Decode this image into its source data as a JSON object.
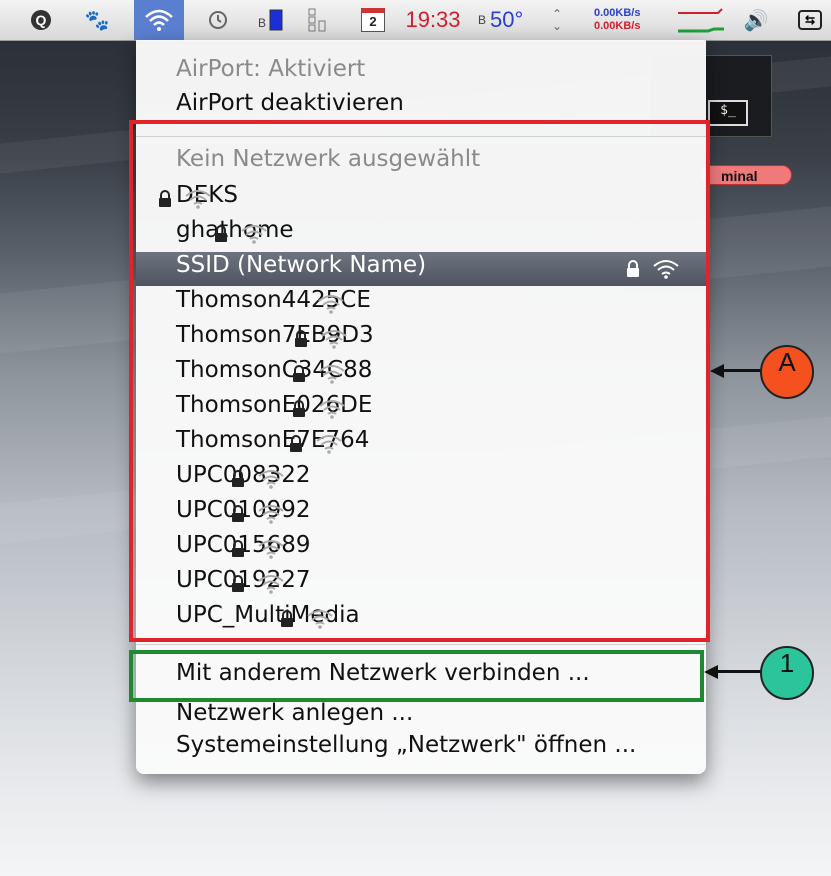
{
  "menubar": {
    "status_icons": [
      "q-icon",
      "paw-icon",
      "wifi-icon",
      "time-machine-icon",
      "battery-icon",
      "cpu-icon",
      "calendar-icon",
      "volume-icon",
      "input-menu-icon"
    ],
    "calendar_day": "2",
    "time": "19:33",
    "temperature": "50°",
    "net_up": "0.00KB/s",
    "net_down": "0.00KB/s"
  },
  "menu": {
    "airport_status": "AirPort: Aktiviert",
    "airport_toggle": "AirPort deaktivieren",
    "no_network": "Kein Netzwerk ausgewählt",
    "networks": [
      {
        "name": "DEKS",
        "locked": true
      },
      {
        "name": "ghathome",
        "locked": true
      },
      {
        "name": "SSID (Network Name)",
        "locked": true,
        "selected": true
      },
      {
        "name": "Thomson4425CE",
        "locked": false
      },
      {
        "name": "Thomson7EB9D3",
        "locked": true
      },
      {
        "name": "ThomsonC34C88",
        "locked": true
      },
      {
        "name": "ThomsonE026DE",
        "locked": true
      },
      {
        "name": "ThomsonE7E764",
        "locked": true
      },
      {
        "name": "UPC008322",
        "locked": true
      },
      {
        "name": "UPC010992",
        "locked": true
      },
      {
        "name": "UPC015689",
        "locked": true
      },
      {
        "name": "UPC019227",
        "locked": true
      },
      {
        "name": "UPC_MultiMedia",
        "locked": true
      }
    ],
    "join_other": "Mit anderem Netzwerk verbinden ...",
    "create_network": "Netzwerk anlegen ...",
    "open_prefs": "Systemeinstellung „Netzwerk\" öffnen ..."
  },
  "desktop": {
    "terminal_prompt": "$_",
    "terminal_label": "minal"
  },
  "annotations": {
    "label_a": "A",
    "label_1": "1",
    "colors": {
      "red_box": "#e0242a",
      "green_box": "#1e8a2f",
      "callout_a": "#f4511e",
      "callout_1": "#2cc49a"
    }
  }
}
